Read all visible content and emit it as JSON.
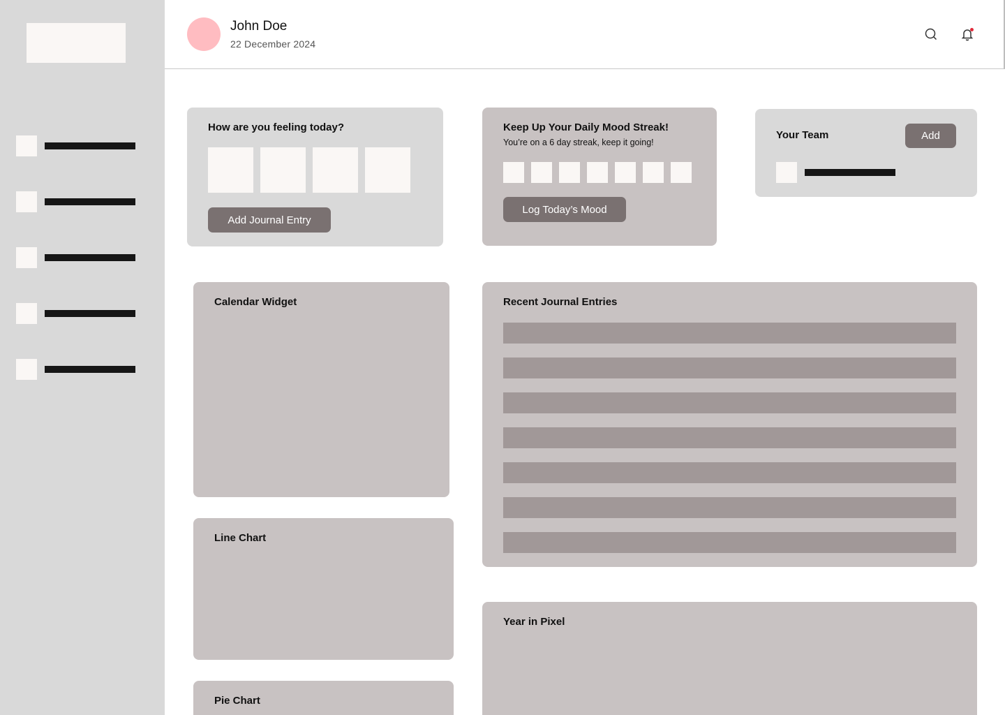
{
  "user": {
    "name": "John Doe",
    "date": "22 December 2024"
  },
  "header": {
    "search_icon": "search-icon",
    "bell_icon": "bell-icon",
    "accent": "#e02a3a",
    "avatar_color": "#ffbcc1"
  },
  "mood_card": {
    "title": "How are you feeling today?",
    "button": "Add Journal Entry"
  },
  "streak_card": {
    "title": "Keep Up Your Daily Mood Streak!",
    "subtitle": "You’re on a 6 day streak, keep it going!",
    "button": "Log Today’s Mood"
  },
  "team_card": {
    "title": "Your Team",
    "button": "Add"
  },
  "calendar_card": {
    "title": "Calendar Widget"
  },
  "journal_card": {
    "title": "Recent Journal Entries"
  },
  "line_chart_card": {
    "title": "Line Chart"
  },
  "pie_chart_card": {
    "title": "Pie Chart"
  },
  "year_card": {
    "title": "Year in Pixel"
  }
}
